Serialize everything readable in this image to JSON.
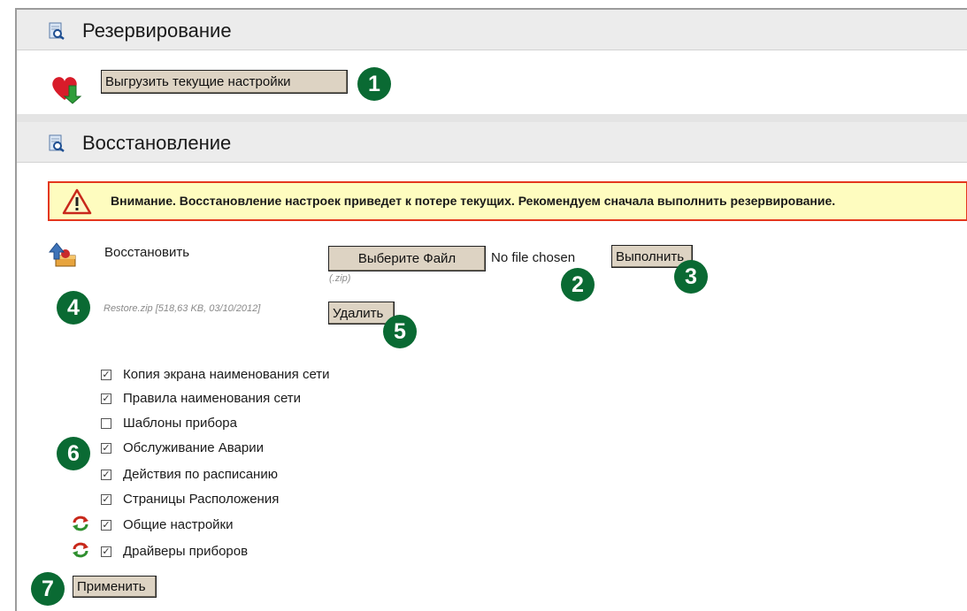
{
  "backup": {
    "title": "Резервирование",
    "export_button": "Выгрузить текущие настройки",
    "badge": "1"
  },
  "restore": {
    "title": "Восстановление",
    "warning": "Внимание. Восстановление настроек приведет к потере текущих. Рекомендуем сначала выполнить резервирование.",
    "restore_label": "Восстановить",
    "choose_file_button": "Выберите Файл",
    "no_file_text": "No file chosen",
    "ext_hint": "(.zip)",
    "execute_button": "Выполнить",
    "file_info": "Restore.zip [518,63 KB, 03/10/2012]",
    "delete_button": "Удалить",
    "apply_button": "Применить",
    "badges": {
      "b2": "2",
      "b3": "3",
      "b4": "4",
      "b5": "5",
      "b6": "6",
      "b7": "7"
    }
  },
  "options": [
    {
      "label": "Копия экрана наименования сети",
      "checked": true,
      "refresh_icon": false
    },
    {
      "label": "Правила наименования сети",
      "checked": true,
      "refresh_icon": false
    },
    {
      "label": "Шаблоны прибора",
      "checked": false,
      "refresh_icon": false
    },
    {
      "label": "Обслуживание Аварии",
      "checked": true,
      "refresh_icon": false
    },
    {
      "label": "Действия по расписанию",
      "checked": true,
      "refresh_icon": false
    },
    {
      "label": "Страницы Расположения",
      "checked": true,
      "refresh_icon": false
    },
    {
      "label": "Общие настройки",
      "checked": true,
      "refresh_icon": true
    },
    {
      "label": "Драйверы приборов",
      "checked": true,
      "refresh_icon": true
    }
  ],
  "colors": {
    "badge": "#0a6a33",
    "button_bg": "#ddd3c3",
    "warning_bg": "#fefcbf",
    "warning_border": "#e4371d",
    "header_bg": "#ececec"
  }
}
